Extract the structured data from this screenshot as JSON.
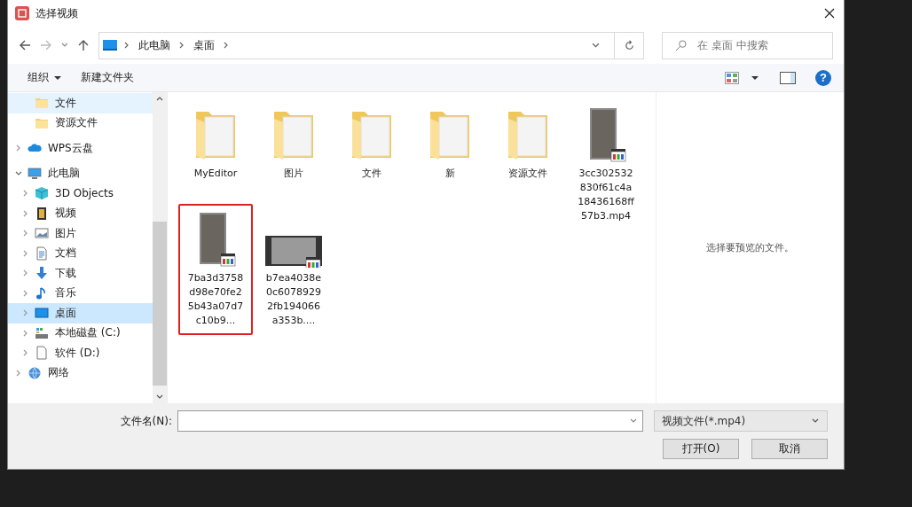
{
  "window": {
    "title": "选择视频"
  },
  "address": {
    "crumbs": [
      "此电脑",
      "桌面"
    ]
  },
  "search": {
    "placeholder": "在 桌面 中搜索"
  },
  "toolbar": {
    "organize": "组织",
    "new_folder": "新建文件夹",
    "help": "?"
  },
  "nav": {
    "quick_access_children": [
      {
        "label": "文件",
        "kind": "folder",
        "selected": false,
        "hover": true
      },
      {
        "label": "资源文件",
        "kind": "folder",
        "selected": false,
        "hover": false
      }
    ],
    "items": [
      {
        "label": "WPS云盘",
        "kind": "cloud",
        "expanded": false,
        "selected": false
      },
      {
        "label": "此电脑",
        "kind": "pc",
        "expanded": true,
        "selected": false,
        "children": [
          {
            "label": "3D Objects",
            "kind": "cube",
            "expanded": false,
            "selected": false
          },
          {
            "label": "视频",
            "kind": "film",
            "expanded": false,
            "selected": false
          },
          {
            "label": "图片",
            "kind": "picture",
            "expanded": false,
            "selected": false
          },
          {
            "label": "文档",
            "kind": "doc",
            "expanded": false,
            "selected": false
          },
          {
            "label": "下载",
            "kind": "download",
            "expanded": false,
            "selected": false
          },
          {
            "label": "音乐",
            "kind": "music",
            "expanded": false,
            "selected": false
          },
          {
            "label": "桌面",
            "kind": "desktop",
            "expanded": false,
            "selected": true
          },
          {
            "label": "本地磁盘 (C:)",
            "kind": "drive",
            "expanded": false,
            "selected": false
          },
          {
            "label": "软件 (D:)",
            "kind": "disk",
            "expanded": false,
            "selected": false
          }
        ]
      },
      {
        "label": "网络",
        "kind": "network",
        "expanded": false,
        "selected": false
      }
    ]
  },
  "files": [
    {
      "name": "MyEditor",
      "kind": "folder",
      "highlighted": false
    },
    {
      "name": "图片",
      "kind": "folder",
      "highlighted": false
    },
    {
      "name": "文件",
      "kind": "folder",
      "highlighted": false
    },
    {
      "name": "新",
      "kind": "folder",
      "highlighted": false
    },
    {
      "name": "资源文件",
      "kind": "folder",
      "highlighted": false
    },
    {
      "name": "3cc302532830f61c4a18436168ff57b3.mp4",
      "kind": "video-portrait",
      "highlighted": false
    },
    {
      "name": "7ba3d3758d98e70fe25b43a07d7c10b9...",
      "kind": "video-portrait",
      "highlighted": true
    },
    {
      "name": "b7ea4038e0c60789292fb194066a353b....",
      "kind": "video-landscape",
      "highlighted": false
    }
  ],
  "preview": {
    "text": "选择要预览的文件。"
  },
  "footer": {
    "filename_label": "文件名(N):",
    "filter": "视频文件(*.mp4)",
    "open": "打开(O)",
    "cancel": "取消"
  }
}
